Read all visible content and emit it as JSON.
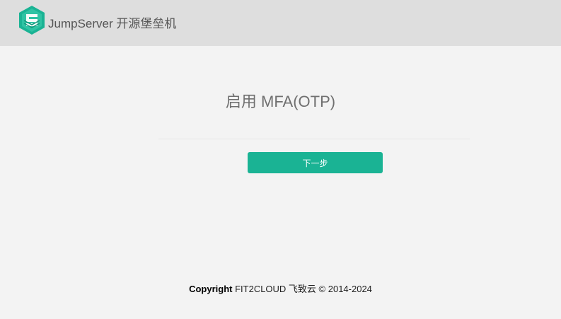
{
  "header": {
    "logo_icon": "jumpserver-logo-icon",
    "brand_text": "JumpServer 开源堡垒机",
    "colors": {
      "background": "#dedede",
      "logo": "#1ab394"
    }
  },
  "main": {
    "title": "启用 MFA(OTP)",
    "next_button_label": "下一步",
    "colors": {
      "accent": "#1ab394",
      "background": "#f3f3f3"
    }
  },
  "footer": {
    "copyright_label": "Copyright",
    "company": "FIT2CLOUD 飞致云 © 2014-2024"
  }
}
